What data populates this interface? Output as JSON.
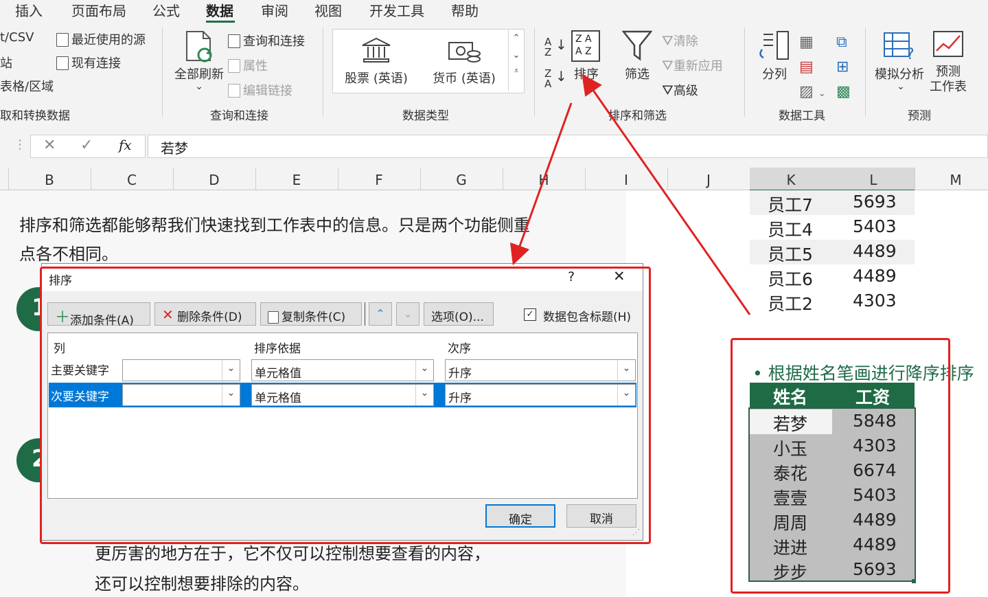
{
  "ribbon": {
    "tabs": [
      "插入",
      "页面布局",
      "公式",
      "数据",
      "审阅",
      "视图",
      "开发工具",
      "帮助"
    ],
    "active_tab": "数据",
    "get_data": {
      "item_csv": "t/CSV",
      "item_web": "站",
      "item_range": "表格/区域",
      "group": "取和转换数据"
    },
    "recent": {
      "recent_sources": "最近使用的源",
      "existing": "现有连接"
    },
    "refresh_all": "全部刷新",
    "queries": {
      "connections": "查询和连接",
      "properties": "属性",
      "edit_links": "编辑链接",
      "group": "查询和连接"
    },
    "datatypes": {
      "stocks": "股票 (英语)",
      "currency": "货币 (英语)",
      "group": "数据类型"
    },
    "sort": {
      "sort": "排序",
      "filter": "筛选",
      "clear": "清除",
      "reapply": "重新应用",
      "advanced": "高级",
      "group": "排序和筛选"
    },
    "tools": {
      "split": "分列",
      "group": "数据工具"
    },
    "forecast": {
      "whatif": "模拟分析",
      "sheet_line1": "预测",
      "sheet_line2": "工作表",
      "group": "预测"
    }
  },
  "formula_bar": {
    "fx": "fx",
    "value": "若梦"
  },
  "columns": [
    "B",
    "C",
    "D",
    "E",
    "F",
    "G",
    "H",
    "I",
    "J",
    "K",
    "L",
    "M"
  ],
  "sheet": {
    "para1_line1": "排序和筛选都能够帮我们快速找到工作表中的信息。只是两个功能侧重",
    "para1_line2": "点各不相同。",
    "para2_line1": "更厉害的地方在于，它不仅可以控制想要查看的内容，",
    "para2_line2": "还可以控制想要排除的内容。",
    "step1": "1",
    "step2": "2",
    "top_table": [
      {
        "name": "员工7",
        "value": "5693"
      },
      {
        "name": "员工4",
        "value": "5403"
      },
      {
        "name": "员工5",
        "value": "4489"
      },
      {
        "name": "员工6",
        "value": "4489"
      },
      {
        "name": "员工2",
        "value": "4303"
      }
    ],
    "note": "根据姓名笔画进行降序排序",
    "table_header": {
      "name": "姓名",
      "value": "工资"
    },
    "table": [
      {
        "name": "若梦",
        "value": "5848"
      },
      {
        "name": "小玉",
        "value": "4303"
      },
      {
        "name": "泰花",
        "value": "6674"
      },
      {
        "name": "壹壹",
        "value": "5403"
      },
      {
        "name": "周周",
        "value": "4489"
      },
      {
        "name": "进进",
        "value": "4489"
      },
      {
        "name": "步步",
        "value": "5693"
      }
    ]
  },
  "dialog": {
    "title": "排序",
    "help": "?",
    "close": "✕",
    "add_level": "添加条件(A)",
    "delete_level": "删除条件(D)",
    "copy_level": "复制条件(C)",
    "options": "选项(O)...",
    "has_headers": "数据包含标题(H)",
    "col_header": "列",
    "sort_on_header": "排序依据",
    "order_header": "次序",
    "row1_label": "主要关键字",
    "row2_label": "次要关键字",
    "sort_on_value": "单元格值",
    "order_value": "升序",
    "ok": "确定",
    "cancel": "取消"
  },
  "colors": {
    "accent_green": "#1e6b45",
    "highlight_red": "#e02222",
    "selection_blue": "#0078d7"
  }
}
